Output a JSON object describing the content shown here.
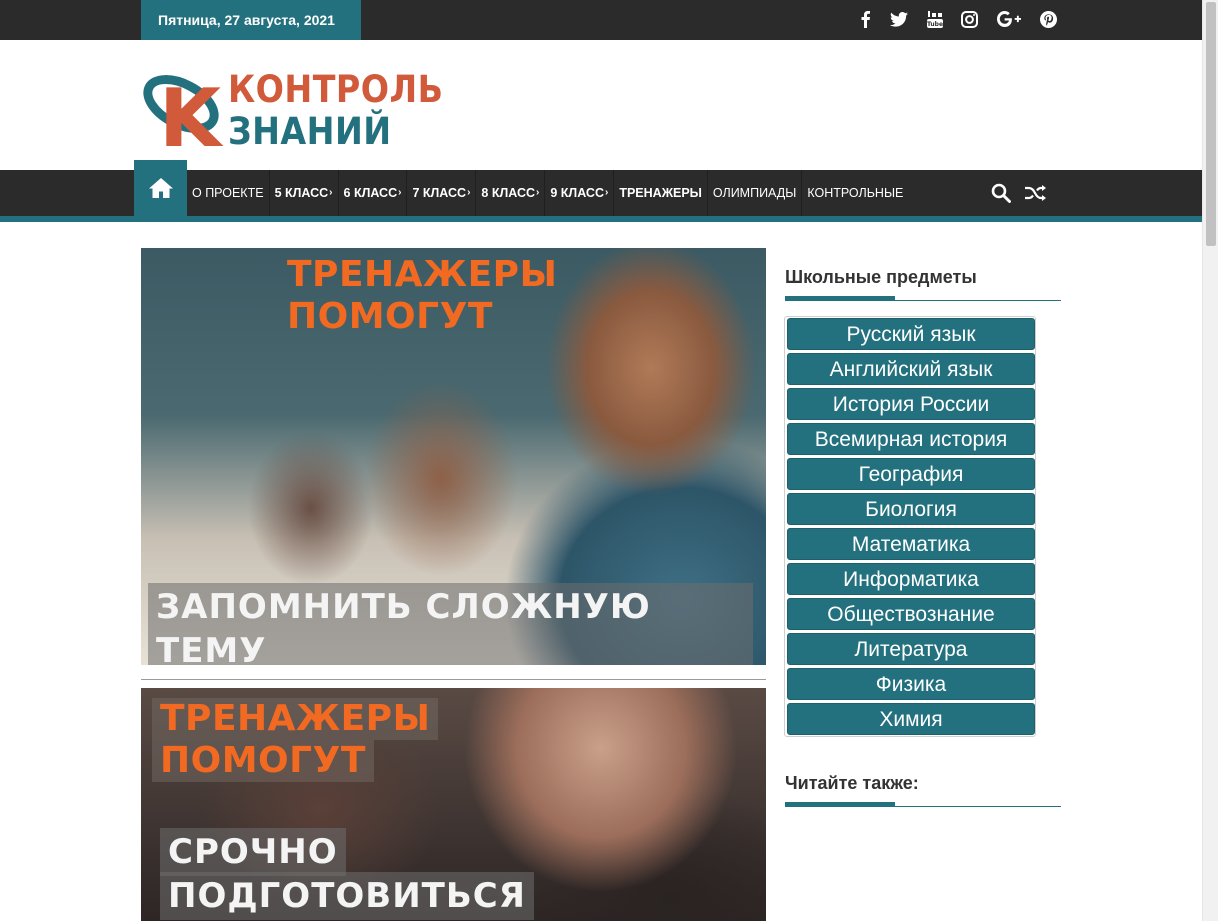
{
  "topbar": {
    "date": "Пятница, 27 августа, 2021",
    "social": [
      "facebook-icon",
      "twitter-icon",
      "youtube-icon",
      "instagram-icon",
      "google-plus-icon",
      "pinterest-icon"
    ]
  },
  "logo": {
    "line1": "КОНТРОЛЬ",
    "line2": "ЗНАНИЙ",
    "mark": "К"
  },
  "nav": {
    "items": [
      {
        "label": "О ПРОЕКТЕ",
        "bold": false,
        "dropdown": false
      },
      {
        "label": "5 КЛАСС",
        "bold": true,
        "dropdown": true
      },
      {
        "label": "6 КЛАСС",
        "bold": true,
        "dropdown": true
      },
      {
        "label": "7 КЛАСС",
        "bold": true,
        "dropdown": true
      },
      {
        "label": "8 КЛАСС",
        "bold": true,
        "dropdown": true
      },
      {
        "label": "9 КЛАСС",
        "bold": true,
        "dropdown": true
      },
      {
        "label": "ТРЕНАЖЕРЫ",
        "bold": true,
        "dropdown": false
      },
      {
        "label": "ОЛИМПИАДЫ",
        "bold": false,
        "dropdown": false
      },
      {
        "label": "КОНТРОЛЬНЫЕ",
        "bold": false,
        "dropdown": false
      }
    ]
  },
  "banners": [
    {
      "title_line1": "ТРЕНАЖЕРЫ",
      "title_line2": "ПОМОГУТ",
      "caption": "ЗАПОМНИТЬ СЛОЖНУЮ ТЕМУ"
    },
    {
      "title_line1": "ТРЕНАЖЕРЫ",
      "title_line2": "ПОМОГУТ",
      "caption_line1": "СРОЧНО",
      "caption_line2": "ПОДГОТОВИТЬСЯ"
    }
  ],
  "sidebar": {
    "subjects_title": "Школьные предметы",
    "subjects": [
      "Русский язык",
      "Английский язык",
      "История России",
      "Всемирная история",
      "География",
      "Биология",
      "Математика",
      "Информатика",
      "Обществознание",
      "Литература",
      "Физика",
      "Химия"
    ],
    "read_also_title": "Читайте также:"
  },
  "colors": {
    "accent": "#23717e",
    "dark": "#2b2b2b",
    "logo_red": "#d15a3a",
    "banner_orange": "#f26a21"
  }
}
